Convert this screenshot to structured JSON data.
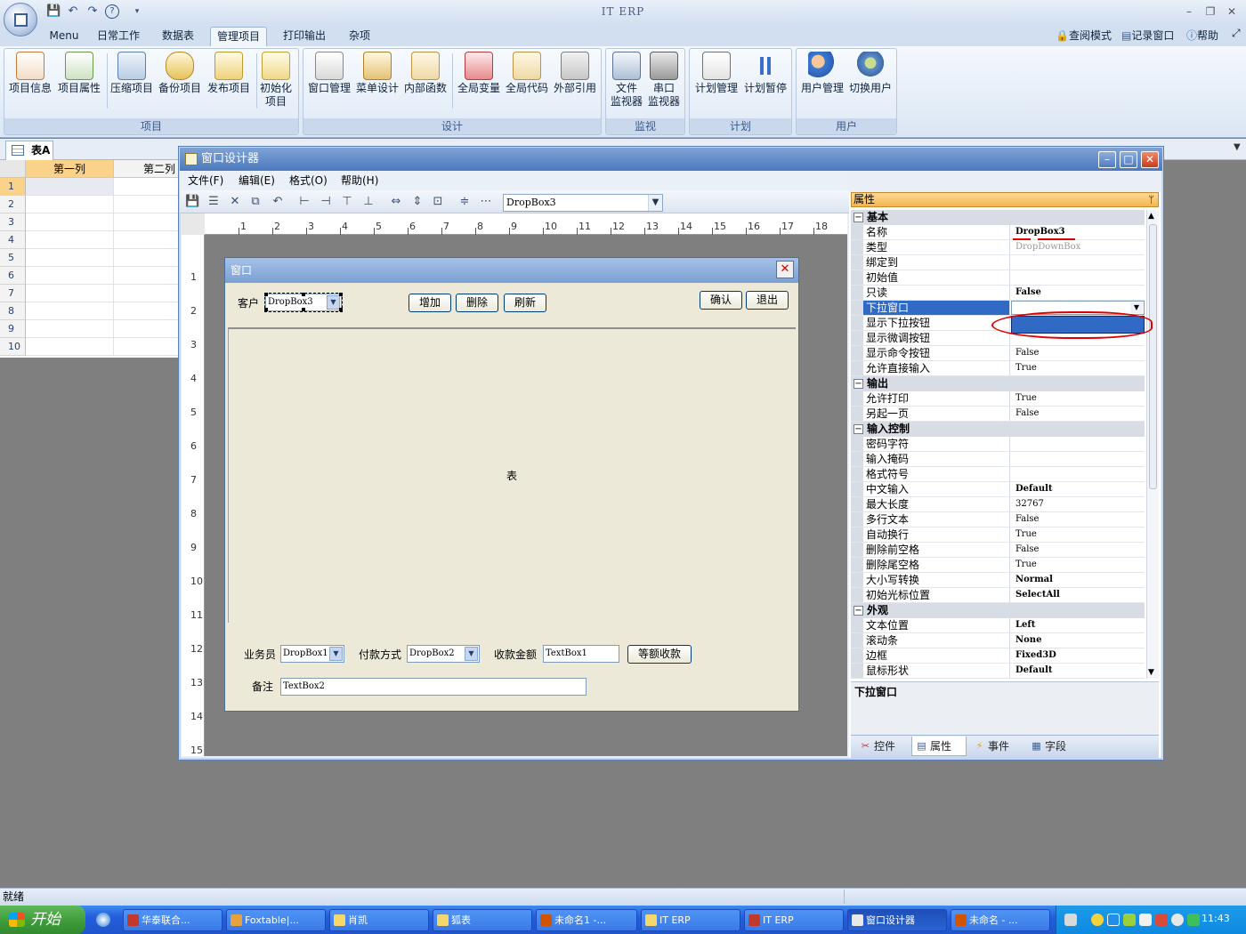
{
  "app": {
    "title": "IT ERP",
    "win_controls": [
      "–",
      "❐",
      "✕"
    ],
    "qat": [
      "💾",
      "↶",
      "↷",
      "?",
      "▾"
    ]
  },
  "ribbon": {
    "tabs": [
      "Menu",
      "日常工作",
      "数据表",
      "管理项目",
      "打印输出",
      "杂项"
    ],
    "active_tab": "管理项目",
    "right_links": [
      "查阅模式",
      "记录窗口",
      "帮助"
    ],
    "groups": [
      {
        "title": "项目",
        "buttons": [
          "项目信息",
          "项目属性",
          "压缩项目",
          "备份项目",
          "发布项目",
          "初始化项目"
        ]
      },
      {
        "title": "设计",
        "buttons": [
          "窗口管理",
          "菜单设计",
          "内部函数",
          "全局变量",
          "全局代码",
          "外部引用"
        ]
      },
      {
        "title": "监视",
        "buttons": [
          "文件监视器",
          "串口监视器"
        ]
      },
      {
        "title": "计划",
        "buttons": [
          "计划管理",
          "计划暂停"
        ]
      },
      {
        "title": "用户",
        "buttons": [
          "用户管理",
          "切换用户"
        ]
      }
    ],
    "btn_labels": {
      "xmxx": "项目信息",
      "xmsx": "项目属性",
      "ysxm": "压缩项目",
      "bfxm": "备份项目",
      "fbxm": "发布项目",
      "csh1": "初始化",
      "csh2": "项目",
      "ckgl": "窗口管理",
      "cdsj": "菜单设计",
      "nbhs": "内部函数",
      "qjbl": "全局变量",
      "qjdm": "全局代码",
      "wbyy": "外部引用",
      "wj1": "文件",
      "wj2": "监视器",
      "ck1": "串口",
      "ck2": "监视器",
      "jhgl": "计划管理",
      "jhzt": "计划暂停",
      "yhgl": "用户管理",
      "qhyh": "切换用户"
    }
  },
  "doc_tab": {
    "label": "表A"
  },
  "sheet": {
    "columns": [
      "第一列",
      "第二列"
    ],
    "rows": [
      "1",
      "2",
      "3",
      "4",
      "5",
      "6",
      "7",
      "8",
      "9",
      "10"
    ]
  },
  "designer": {
    "title": "窗口设计器",
    "menu": [
      "文件(F)",
      "编辑(E)",
      "格式(O)",
      "帮助(H)"
    ],
    "toolbar_icons": [
      "save-icon",
      "properties-icon",
      "cut-icon",
      "copy-icon",
      "undo-icon",
      "align-left-icon",
      "align-right-icon",
      "align-top-icon",
      "align-bottom-icon",
      "same-width-icon",
      "same-height-icon",
      "same-size-icon",
      "vspace-icon",
      "hspace-icon"
    ],
    "control_select": "DropBox3",
    "ruler_h": [
      "1",
      "2",
      "3",
      "4",
      "5",
      "6",
      "7",
      "8",
      "9",
      "10",
      "11",
      "12",
      "13",
      "14",
      "15",
      "16",
      "17",
      "18"
    ],
    "ruler_v": [
      "1",
      "2",
      "3",
      "4",
      "5",
      "6",
      "7",
      "8",
      "9",
      "10",
      "11",
      "12",
      "13",
      "14",
      "15"
    ]
  },
  "form": {
    "title": "窗口",
    "customer_label": "客户",
    "customer_dropdown": "DropBox3",
    "buttons": {
      "add": "增加",
      "delete": "删除",
      "refresh": "刷新",
      "confirm": "确认",
      "exit": "退出",
      "collect": "等额收款"
    },
    "table_label": "表",
    "salesman_label": "业务员",
    "salesman_dropdown": "DropBox1",
    "payment_label": "付款方式",
    "payment_dropdown": "DropBox2",
    "amount_label": "收款金额",
    "amount_textbox": "TextBox1",
    "note_label": "备注",
    "note_textbox": "TextBox2"
  },
  "properties": {
    "header": "属性",
    "pin": "ᛘ",
    "categories": {
      "basic": "基本",
      "output": "输出",
      "input": "输入控制",
      "appearance": "外观"
    },
    "basic": [
      {
        "name": "名称",
        "value": "DropBox3",
        "bold": true
      },
      {
        "name": "类型",
        "value": "DropDownBox",
        "muted": true
      },
      {
        "name": "绑定到",
        "value": ""
      },
      {
        "name": "初始值",
        "value": ""
      },
      {
        "name": "只读",
        "value": "False",
        "bold": true
      },
      {
        "name": "下拉窗口",
        "value": "",
        "selected": true
      },
      {
        "name": "显示下拉按钮",
        "value": ""
      },
      {
        "name": "显示微调按钮",
        "value": ""
      },
      {
        "name": "显示命令按钮",
        "value": "False"
      },
      {
        "name": "允许直接输入",
        "value": "True"
      }
    ],
    "output": [
      {
        "name": "允许打印",
        "value": "True"
      },
      {
        "name": "另起一页",
        "value": "False"
      }
    ],
    "input": [
      {
        "name": "密码字符",
        "value": ""
      },
      {
        "name": "输入掩码",
        "value": ""
      },
      {
        "name": "格式符号",
        "value": ""
      },
      {
        "name": "中文输入",
        "value": "Default",
        "bold": true
      },
      {
        "name": "最大长度",
        "value": "32767"
      },
      {
        "name": "多行文本",
        "value": "False"
      },
      {
        "name": "自动换行",
        "value": "True"
      },
      {
        "name": "删除前空格",
        "value": "False"
      },
      {
        "name": "删除尾空格",
        "value": "True"
      },
      {
        "name": "大小写转换",
        "value": "Normal",
        "bold": true
      },
      {
        "name": "初始光标位置",
        "value": "SelectAll",
        "bold": true
      }
    ],
    "appearance": [
      {
        "name": "文本位置",
        "value": "Left",
        "bold": true
      },
      {
        "name": "滚动条",
        "value": "None",
        "bold": true
      },
      {
        "name": "边框",
        "value": "Fixed3D",
        "bold": true
      },
      {
        "name": "鼠标形状",
        "value": "Default",
        "bold": true
      }
    ],
    "description_title": "下拉窗口",
    "tabs": [
      "控件",
      "属性",
      "事件",
      "字段"
    ],
    "active_tab": "属性"
  },
  "statusbar": {
    "text": "就绪"
  },
  "taskbar": {
    "start": "开始",
    "items": [
      "华泰联合...",
      "Foxtable|...",
      "肖凯",
      "狐表",
      "未命名1 -...",
      "IT ERP",
      "IT ERP",
      "窗口设计器",
      "未命名 - ..."
    ],
    "active_item": "窗口设计器",
    "clock": "11:43"
  },
  "colors": {
    "accent": "#316ac5",
    "annotation": "#e00000",
    "ribbon_text": "#10243f"
  }
}
